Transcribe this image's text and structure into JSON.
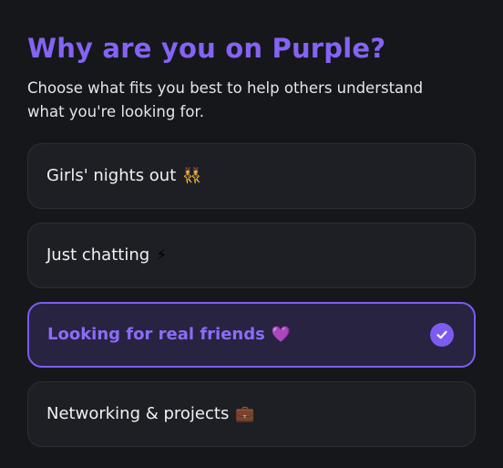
{
  "header": {
    "title": "Why are you on Purple?",
    "subtitle": "Choose what fits you best to help others understand what you're looking for."
  },
  "options": [
    {
      "label": "Girls' nights out",
      "emoji": "👯‍♀️",
      "icon": "dancing-women-icon",
      "selected": false
    },
    {
      "label": "Just chatting",
      "emoji": "⚡",
      "icon": "lightning-icon",
      "selected": false
    },
    {
      "label": "Looking for real friends",
      "emoji": "💜",
      "icon": "purple-heart-icon",
      "selected": true
    },
    {
      "label": "Networking & projects",
      "emoji": "💼",
      "icon": "briefcase-icon",
      "selected": false
    }
  ],
  "colors": {
    "background": "#16171b",
    "card": "#1e1f24",
    "accent": "#7c5cf0",
    "title": "#8563f4"
  }
}
